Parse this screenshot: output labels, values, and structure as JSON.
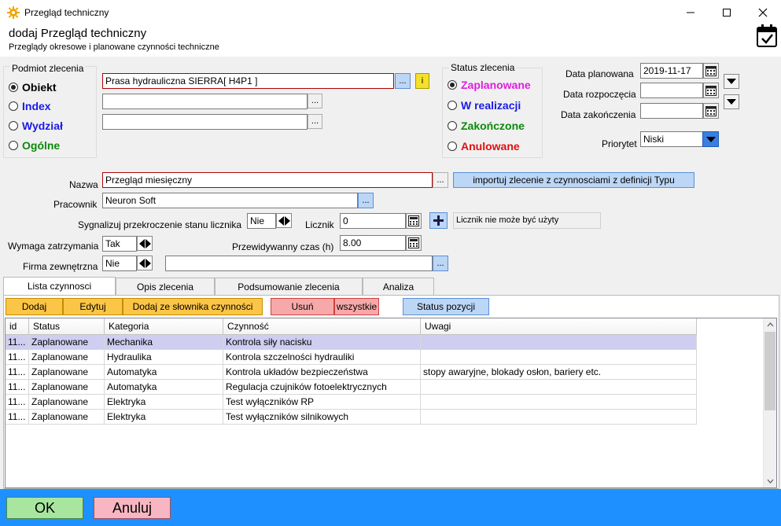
{
  "window": {
    "title": "Przegląd techniczny",
    "header_title": "dodaj Przegląd techniczny",
    "header_subtitle": "Przeglądy okresowe i planowane czynności techniczne"
  },
  "subject": {
    "group_label": "Podmiot zlecenia",
    "options": [
      {
        "label": "Obiekt",
        "color": "#000000",
        "checked": true
      },
      {
        "label": "Index",
        "color": "#1a1ae6",
        "checked": false
      },
      {
        "label": "Wydział",
        "color": "#1a1ae6",
        "checked": false
      },
      {
        "label": "Ogólne",
        "color": "#0a8a0a",
        "checked": false
      }
    ],
    "object_value": "Prasa hydrauliczna SIERRA[ H4P1 ]",
    "field2_value": "",
    "field3_value": "",
    "dots": "...",
    "info_label": "i"
  },
  "status": {
    "group_label": "Status zlecenia",
    "options": [
      {
        "label": "Zaplanowane",
        "color": "#e01ee0",
        "checked": true
      },
      {
        "label": "W realizacji",
        "color": "#1a1ae6",
        "checked": false
      },
      {
        "label": "Zakończone",
        "color": "#0a8a0a",
        "checked": false
      },
      {
        "label": "Anulowane",
        "color": "#e01010",
        "checked": false
      }
    ]
  },
  "dates": {
    "planned_label": "Data planowana",
    "planned_value": "2019-11-17",
    "start_label": "Data rozpoczęcia",
    "start_value": "",
    "end_label": "Data zakończenia",
    "end_value": "",
    "priority_label": "Priorytet",
    "priority_value": "Niski"
  },
  "form": {
    "name_label": "Nazwa",
    "name_value": "Przegląd miesięczny",
    "import_button": "importuj zlecenie z czynnosciami z definicji Typu",
    "worker_label": "Pracownik",
    "worker_value": "Neuron Soft",
    "signal_label": "Sygnalizuj przekroczenie stanu licznika",
    "signal_value": "Nie",
    "counter_label": "Licznik",
    "counter_value": "0",
    "counter_info": "Licznik nie może być użyty",
    "stop_label": "Wymaga zatrzymania",
    "stop_value": "Tak",
    "time_label": "Przewidywanny czas  (h)",
    "time_value": "8.00",
    "company_label": "Firma zewnętrzna",
    "company_value": "Nie",
    "company_field": ""
  },
  "tabs": [
    {
      "label": "Lista czynnosci",
      "active": true
    },
    {
      "label": "Opis zlecenia",
      "active": false
    },
    {
      "label": "Podsumowanie zlecenia",
      "active": false
    },
    {
      "label": "Analiza",
      "active": false
    }
  ],
  "toolbar": {
    "add": "Dodaj",
    "edit": "Edytuj",
    "add_dict": "Dodaj ze słownika czynności",
    "delete": "Usuń",
    "all": "wszystkie",
    "pos_status": "Status pozycji"
  },
  "table": {
    "columns": [
      "id",
      "Status",
      "Kategoria",
      "Czynność",
      "Uwagi"
    ],
    "rows": [
      [
        "11...",
        "Zaplanowane",
        "Mechanika",
        "Kontrola siły nacisku",
        ""
      ],
      [
        "11...",
        "Zaplanowane",
        "Hydraulika",
        "Kontrola szczelności hydrauliki",
        ""
      ],
      [
        "11...",
        "Zaplanowane",
        "Automatyka",
        "Kontrola układów bezpieczeństwa",
        "stopy awaryjne, blokady osłon, bariery etc."
      ],
      [
        "11...",
        "Zaplanowane",
        "Automatyka",
        "Regulacja czujników fotoelektrycznych",
        ""
      ],
      [
        "11...",
        "Zaplanowane",
        "Elektryka",
        "Test wyłączników RP",
        ""
      ],
      [
        "11...",
        "Zaplanowane",
        "Elektryka",
        "Test wyłączników silnikowych",
        ""
      ]
    ]
  },
  "footer": {
    "ok": "OK",
    "cancel": "Anuluj"
  },
  "colors": {
    "accent_blue": "#1e90ff",
    "ok_green": "#a8e6a0",
    "cancel_red": "#f7b6c2"
  },
  "icons": {
    "title": "gear-icon",
    "header": "calendar-check-icon",
    "calendar": "calendar-icon"
  }
}
